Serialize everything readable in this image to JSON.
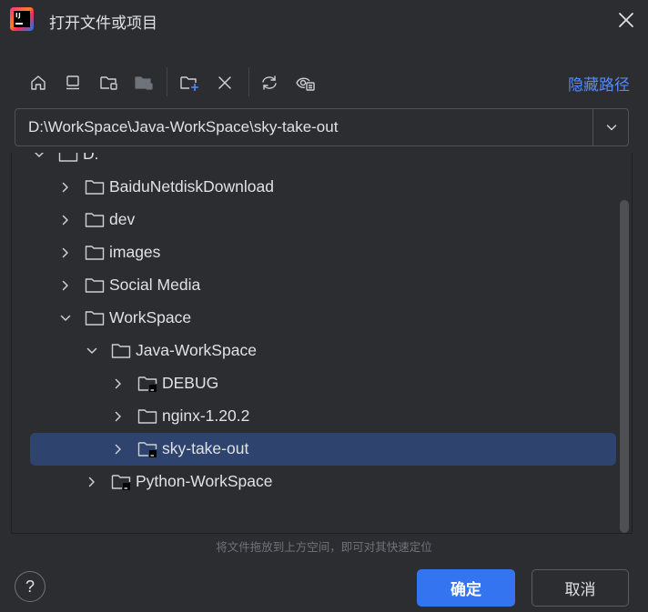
{
  "window": {
    "title": "打开文件或项目",
    "app_icon": "intellij-idea-icon",
    "close_icon": "close-icon"
  },
  "toolbar": {
    "buttons": [
      {
        "icon": "home-icon"
      },
      {
        "icon": "desktop-icon"
      },
      {
        "icon": "project-folder-icon"
      },
      {
        "icon": "module-folder-icon"
      },
      {
        "icon": "new-folder-icon"
      },
      {
        "icon": "delete-icon"
      },
      {
        "icon": "refresh-icon"
      },
      {
        "icon": "show-hidden-icon"
      }
    ],
    "hide_path_label": "隐藏路径"
  },
  "path": {
    "value": "D:\\WorkSpace\\Java-WorkSpace\\sky-take-out"
  },
  "tree": {
    "items": [
      {
        "label": "D:",
        "expanded": true,
        "project": false
      },
      {
        "label": "BaiduNetdiskDownload",
        "expanded": false,
        "project": false
      },
      {
        "label": "dev",
        "expanded": false,
        "project": false
      },
      {
        "label": "images",
        "expanded": false,
        "project": false
      },
      {
        "label": "Social Media",
        "expanded": false,
        "project": false
      },
      {
        "label": "WorkSpace",
        "expanded": true,
        "project": false
      },
      {
        "label": "Java-WorkSpace",
        "expanded": true,
        "project": false
      },
      {
        "label": "DEBUG",
        "expanded": false,
        "project": true
      },
      {
        "label": "nginx-1.20.2",
        "expanded": false,
        "project": false
      },
      {
        "label": "sky-take-out",
        "expanded": false,
        "project": true,
        "selected": true
      },
      {
        "label": "Python-WorkSpace",
        "expanded": false,
        "project": true
      }
    ]
  },
  "hint": "将文件拖放到上方空间，即可对其快速定位",
  "footer": {
    "help_label": "?",
    "ok_label": "确定",
    "cancel_label": "取消"
  },
  "colors": {
    "background": "#2b2d30",
    "accent": "#3574f0",
    "link": "#548af7",
    "selection": "#2e436e"
  }
}
